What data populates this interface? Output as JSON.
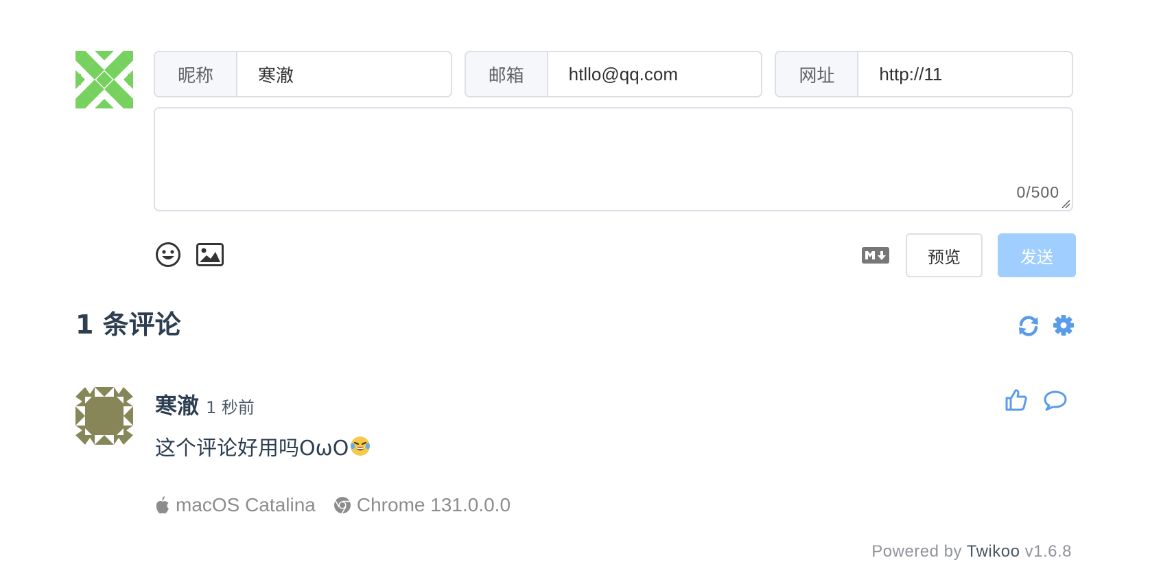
{
  "form": {
    "nick": {
      "label": "昵称",
      "value": "寒澈"
    },
    "mail": {
      "label": "邮箱",
      "value": "htllo@qq.com"
    },
    "link": {
      "label": "网址",
      "value": "http://11"
    },
    "textarea": {
      "value": "",
      "counter": "0/500"
    },
    "icons": {
      "emoji": "emoji-icon",
      "image": "image-upload-icon",
      "markdown": "markdown-icon"
    },
    "preview_label": "预览",
    "send_label": "发送"
  },
  "comments": {
    "count_title": "1 条评论",
    "icons": {
      "refresh": "refresh-icon",
      "settings": "gear-icon"
    },
    "items": [
      {
        "nick": "寒澈",
        "time": "1 秒前",
        "text": "这个评论好用吗OωO",
        "emoji": "😂",
        "os": "macOS Catalina",
        "browser": "Chrome 131.0.0.0"
      }
    ]
  },
  "footer": {
    "powered_prefix": "Powered by ",
    "brand": "Twikoo",
    "version": " v1.6.8"
  },
  "colors": {
    "accent": "#409eff",
    "icon_blue": "#5a9bea",
    "send_disabled": "#a0cfff",
    "avatar_self": "#77d15f",
    "avatar_comment": "#868659"
  }
}
